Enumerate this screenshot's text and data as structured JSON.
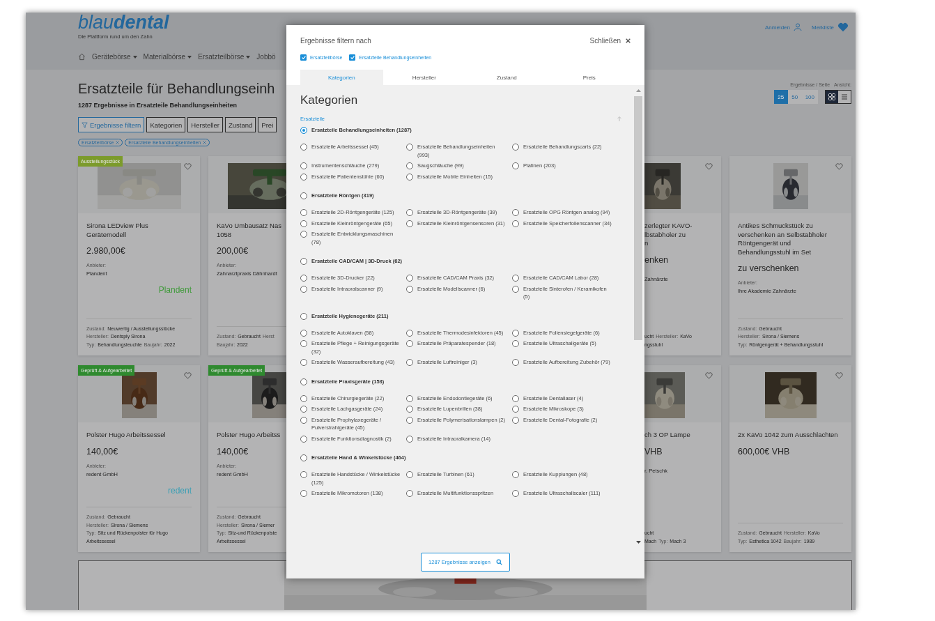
{
  "header": {
    "logo": {
      "light": "blau",
      "bold": "dental"
    },
    "tagline": "Die Plattform rund um den Zahn",
    "nav": [
      {
        "label": "Gerätebörse",
        "dropdown": true
      },
      {
        "label": "Materialbörse",
        "dropdown": true
      },
      {
        "label": "Ersatzteilbörse",
        "dropdown": true
      },
      {
        "label": "Jobbö",
        "dropdown": false
      }
    ],
    "login": "Anmelden",
    "wishlist": "Merkliste"
  },
  "listing": {
    "title": "Ersatzteile für Behandlungseinh",
    "subtitle": "1287 Ergebnisse in Ersatzteile Behandlungseinheiten",
    "filter_button": "Ergebnisse filtern",
    "filter_tabs": [
      "Kategorien",
      "Hersteller",
      "Zustand",
      "Prei"
    ],
    "active_filters": [
      "Ersatzteilbörse",
      "Ersatzteile Behandlungseinheiten"
    ],
    "per_page_label": "Ergebnisse / Seite",
    "view_label": "Ansicht:",
    "per_page": [
      {
        "label": "25",
        "selected": true
      },
      {
        "label": "50",
        "selected": false
      },
      {
        "label": "100",
        "selected": false
      }
    ],
    "view": [
      {
        "kind": "grid",
        "selected": true
      },
      {
        "kind": "list",
        "selected": false
      }
    ]
  },
  "card_rows": [
    {
      "left": [
        {
          "badge": {
            "label": "Ausstellungsstück",
            "color": "#7c9b2b"
          },
          "wishlisted": false,
          "title_lines": [
            "Sirona LEDview Plus",
            "Gerätemodell"
          ],
          "price": "2.980,00€",
          "provider_label": "Anbieter:",
          "provider": "Plandent",
          "brand_logo": {
            "text": "Plandent",
            "color": "#3f9a3a"
          },
          "details": [
            [
              {
                "kind": "label",
                "text": "Zustand:"
              },
              {
                "kind": "value",
                "text": "Neuwertig / Ausstellungsstücke"
              }
            ],
            [
              {
                "kind": "label",
                "text": "Hersteller:"
              },
              {
                "kind": "value",
                "text": "Dentsply Sirona"
              }
            ],
            [
              {
                "kind": "label",
                "text": "Typ:"
              },
              {
                "kind": "value",
                "text": "Behandlungsleuchte"
              },
              {
                "kind": "label",
                "text": "Baujahr:"
              },
              {
                "kind": "value",
                "text": "2022"
              }
            ]
          ]
        },
        {
          "title_lines": [
            "KaVo Umbausatz Nas",
            "1058"
          ],
          "price": "200,00€",
          "provider_label": "Anbieter:",
          "provider": "Zahnarztpraxis Dähnhardt",
          "details": [
            [
              {
                "kind": "label",
                "text": "Zustand:"
              },
              {
                "kind": "value",
                "text": "Gebraucht"
              },
              {
                "kind": "label",
                "text": "Herst"
              }
            ],
            [
              {
                "kind": "label",
                "text": "Baujahr:"
              },
              {
                "kind": "value",
                "text": "2022"
              }
            ]
          ]
        }
      ],
      "right": [
        {
          "wishlisted": false,
          "title_lines": [
            "zerlegter KAVO-",
            "lbstabholer zu",
            "n"
          ],
          "price": "enken",
          "provider": "Zahnärzte",
          "details": [
            [
              {
                "kind": "value",
                "text": "ucht"
              },
              {
                "kind": "label",
                "text": "Hersteller:"
              },
              {
                "kind": "value",
                "text": "KaVo"
              }
            ],
            [
              {
                "kind": "value",
                "text": "ngsstuhl"
              }
            ]
          ]
        },
        {
          "wishlisted": false,
          "title_lines": [
            "Antikes Schmuckstück zu",
            "verschenken an Selbstabholer",
            "Röntgengerät und",
            "Behandlungsstuhl im Set"
          ],
          "price": "zu verschenken",
          "provider_label": "Anbieter:",
          "provider": "Ihre Akademie Zahnärzte",
          "details": [
            [
              {
                "kind": "label",
                "text": "Zustand:"
              },
              {
                "kind": "value",
                "text": "Gebraucht"
              }
            ],
            [
              {
                "kind": "label",
                "text": "Hersteller:"
              },
              {
                "kind": "value",
                "text": "Sirona / Siemens"
              }
            ],
            [
              {
                "kind": "label",
                "text": "Typ:"
              },
              {
                "kind": "value",
                "text": "Röntgengerät + Behandlungsstuhl"
              }
            ]
          ]
        }
      ]
    },
    {
      "left": [
        {
          "badge": {
            "label": "Geprüft & Aufgearbeitet",
            "color": "#2f8a2f"
          },
          "wishlisted": false,
          "title_lines": [
            "Polster Hugo Arbeitssessel"
          ],
          "price": "140,00€",
          "provider_label": "Anbieter:",
          "provider": "redent GmbH",
          "brand_logo": {
            "text": "redent",
            "color": "#3a9fb5"
          },
          "details": [
            [
              {
                "kind": "label",
                "text": "Zustand:"
              },
              {
                "kind": "value",
                "text": "Gebraucht"
              }
            ],
            [
              {
                "kind": "label",
                "text": "Hersteller:"
              },
              {
                "kind": "value",
                "text": "Sirona / Siemens"
              }
            ],
            [
              {
                "kind": "label",
                "text": "Typ:"
              },
              {
                "kind": "value",
                "text": "Sitz und Rückenpolster für Hugo Arbeitssessel"
              }
            ]
          ]
        },
        {
          "badge": {
            "label": "Geprüft & Aufgearbeitet",
            "color": "#2f8a2f"
          },
          "title_lines": [
            "Polster Hugo Arbeitss"
          ],
          "price": "140,00€",
          "provider_label": "Anbieter:",
          "provider": "redent GmbH",
          "details": [
            [
              {
                "kind": "label",
                "text": "Zustand:"
              },
              {
                "kind": "value",
                "text": "Gebraucht"
              }
            ],
            [
              {
                "kind": "label",
                "text": "Hersteller:"
              },
              {
                "kind": "value",
                "text": "Sirona / Siemer"
              }
            ],
            [
              {
                "kind": "label",
                "text": "Typ:"
              },
              {
                "kind": "value",
                "text": "Sitz-und Rückenpolste"
              }
            ],
            [
              {
                "kind": "value",
                "text": "Arbeitssessel"
              }
            ]
          ]
        }
      ],
      "right": [
        {
          "wishlisted": false,
          "title_lines": [
            "ch 3 OP Lampe"
          ],
          "price": "VHB",
          "provider": "r. Petschk",
          "details": [
            [
              {
                "kind": "value",
                "text": "ucht"
              }
            ],
            [
              {
                "kind": "value",
                "text": "Mach"
              },
              {
                "kind": "label",
                "text": "Typ:"
              },
              {
                "kind": "value",
                "text": "Mach 3"
              }
            ]
          ]
        },
        {
          "wishlisted": false,
          "title_lines": [
            "2x KaVo 1042 zum Ausschlachten"
          ],
          "price": "600,00€ VHB",
          "details": [
            [
              {
                "kind": "label",
                "text": "Zustand:"
              },
              {
                "kind": "value",
                "text": "Gebraucht"
              },
              {
                "kind": "label",
                "text": "Hersteller:"
              },
              {
                "kind": "value",
                "text": "KaVo"
              }
            ],
            [
              {
                "kind": "label",
                "text": "Typ:"
              },
              {
                "kind": "value",
                "text": "Esthetica 1042"
              },
              {
                "kind": "label",
                "text": "Baujahr:"
              },
              {
                "kind": "value",
                "text": "1989"
              }
            ]
          ]
        }
      ]
    }
  ],
  "modal": {
    "title": "Ergebnisse filtern nach",
    "close": "Schließen",
    "chips": [
      {
        "label": "Ersatzteilbörse",
        "checked": true
      },
      {
        "label": "Ersatzteile Behandlungseinheiten",
        "checked": true
      }
    ],
    "tabs": [
      {
        "label": "Kategorien",
        "selected": true
      },
      {
        "label": "Hersteller",
        "selected": false
      },
      {
        "label": "Zustand",
        "selected": false
      },
      {
        "label": "Preis",
        "selected": false
      }
    ],
    "heading": "Kategorien",
    "section": "Ersatzteile",
    "groups": [
      {
        "label": "Ersatzteile Behandlungseinheiten (1287)",
        "selected": true,
        "options": [
          {
            "label": "Ersatzteile Arbeitssessel (45)",
            "selected": false
          },
          {
            "label": "Ersatzteile Behandlungseinheiten (993)",
            "selected": false
          },
          {
            "label": "Ersatzteile Behandlungscarts (22)",
            "selected": false
          },
          {
            "label": "Instrumentenschläuche (279)",
            "selected": false
          },
          {
            "label": "Saugschläuche (99)",
            "selected": false
          },
          {
            "label": "Platinen (203)",
            "selected": false
          },
          {
            "label": "Ersatzteile Patientenstühle (60)",
            "selected": false
          },
          {
            "label": "Ersatzteile Mobile Einheiten (15)",
            "selected": false
          }
        ]
      },
      {
        "label": "Ersatzteile Röntgen (319)",
        "selected": false,
        "options": [
          {
            "label": "Ersatzteile 2D-Röntgengeräte (125)",
            "selected": false
          },
          {
            "label": "Ersatzteile 3D-Röntgengeräte (39)",
            "selected": false
          },
          {
            "label": "Ersatzteile OPG Röntgen analog (94)",
            "selected": false
          },
          {
            "label": "Ersatzteile Kleinröntgengeräte (65)",
            "selected": false
          },
          {
            "label": "Ersatzteile Kleinröntgensensoren (31)",
            "selected": false
          },
          {
            "label": "Ersatzteile Speicherfolienscanner (34)",
            "selected": false
          },
          {
            "label": "Ersatzteile Entwicklungsmaschinen (78)",
            "selected": false
          }
        ]
      },
      {
        "label": "Ersatzteile CAD/CAM | 3D-Druck (62)",
        "selected": false,
        "options": [
          {
            "label": "Ersatzteile 3D-Drucker (22)",
            "selected": false
          },
          {
            "label": "Ersatzteile CAD/CAM Praxis (32)",
            "selected": false
          },
          {
            "label": "Ersatzteile CAD/CAM Labor (28)",
            "selected": false
          },
          {
            "label": "Ersatzteile Intraoralscanner (9)",
            "selected": false
          },
          {
            "label": "Ersatzteile Modellscanner (6)",
            "selected": false
          },
          {
            "label": "Ersatzteile Sinterofen / Keramikofen (5)",
            "selected": false
          }
        ]
      },
      {
        "label": "Ersatzteile Hygienegeräte (211)",
        "selected": false,
        "options": [
          {
            "label": "Ersatzteile Autoklaven (58)",
            "selected": false
          },
          {
            "label": "Ersatzteile Thermodesinfektoren (45)",
            "selected": false
          },
          {
            "label": "Ersatzteile Foliensiegelgeräte (6)",
            "selected": false
          },
          {
            "label": "Ersatzteile Pflege + Reinigungsgeräte (32)",
            "selected": false
          },
          {
            "label": "Ersatzteile Präparatespender (18)",
            "selected": false
          },
          {
            "label": "Ersatzteile Ultraschallgeräte (5)",
            "selected": false
          },
          {
            "label": "Ersatzteile Wasseraufbereitung (43)",
            "selected": false
          },
          {
            "label": "Ersatzteile Luftreiniger (3)",
            "selected": false
          },
          {
            "label": "Ersatzteile Aufbereitung Zubehör (79)",
            "selected": false
          }
        ]
      },
      {
        "label": "Ersatzteile Praxisgeräte (153)",
        "selected": false,
        "options": [
          {
            "label": "Ersatzteile Chirurgiegeräte (22)",
            "selected": false
          },
          {
            "label": "Ersatzteile Endodontiegeräte (6)",
            "selected": false
          },
          {
            "label": "Ersatzteile Dentallaser (4)",
            "selected": false
          },
          {
            "label": "Ersatzteile Lachgasgeräte (24)",
            "selected": false
          },
          {
            "label": "Ersatzteile Lupenbrillen (38)",
            "selected": false
          },
          {
            "label": "Ersatzteile Mikroskope (3)",
            "selected": false
          },
          {
            "label": "Ersatzteile Prophylaxegeräte / Pulverstrahlgeräte (45)",
            "selected": false
          },
          {
            "label": "Ersatzteile Polymerisationslampen (2)",
            "selected": false
          },
          {
            "label": "Ersatzteile Dental-Fotografie (2)",
            "selected": false
          },
          {
            "label": "Ersatzteile Funktionsdiagnostik (2)",
            "selected": false
          },
          {
            "label": "Ersatzteile Intraoralkamera (14)",
            "selected": false
          }
        ]
      },
      {
        "label": "Ersatzteile Hand & Winkelstücke (464)",
        "selected": false,
        "options": [
          {
            "label": "Ersatzteile Handstücke / Winkelstücke (125)",
            "selected": false
          },
          {
            "label": "Ersatzteile Turbinen (61)",
            "selected": false
          },
          {
            "label": "Ersatzteile Kupplungen (48)",
            "selected": false
          },
          {
            "label": "Ersatzteile Mikromotoren (138)",
            "selected": false
          },
          {
            "label": "Ersatzteile Multifunktionsspritzen",
            "selected": false
          },
          {
            "label": "Ersatzteile Ultraschallscaler (111)",
            "selected": false
          }
        ]
      }
    ],
    "submit": "1287 Ergebnisse anzeigen"
  }
}
